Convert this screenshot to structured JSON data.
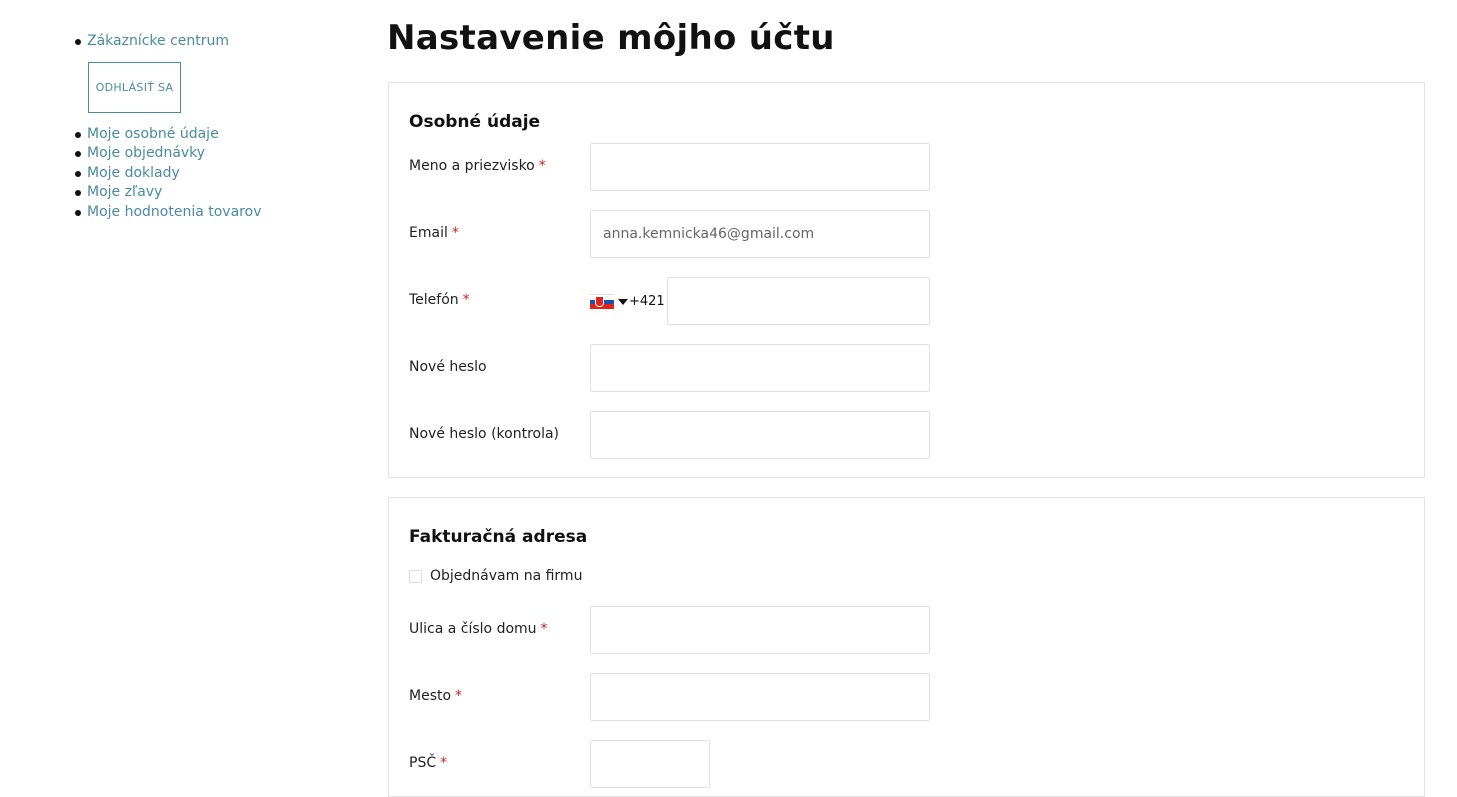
{
  "sidebar": {
    "customer_center": "Zákaznícke centrum",
    "logout_label": "ODHLÁSIŤ SA",
    "items": [
      {
        "label": "Moje osobné údaje"
      },
      {
        "label": "Moje objednávky"
      },
      {
        "label": "Moje doklady"
      },
      {
        "label": "Moje zľavy"
      },
      {
        "label": "Moje hodnotenia tovarov"
      }
    ]
  },
  "page": {
    "title": "Nastavenie môjho účtu"
  },
  "personal": {
    "heading": "Osobné údaje",
    "name": {
      "label": "Meno a priezvisko",
      "required": "*",
      "value": ""
    },
    "email": {
      "label": "Email",
      "required": "*",
      "value": "anna.kemnicka46@gmail.com"
    },
    "phone": {
      "label": "Telefón",
      "required": "*",
      "country": "slovakia-flag-icon",
      "prefix": "+421",
      "value": ""
    },
    "new_password": {
      "label": "Nové heslo",
      "value": ""
    },
    "new_password_check": {
      "label": "Nové heslo (kontrola)",
      "value": ""
    }
  },
  "billing": {
    "heading": "Fakturačná adresa",
    "company_checkbox": {
      "label": "Objednávam na firmu",
      "checked": false
    },
    "street": {
      "label": "Ulica a číslo domu",
      "required": "*",
      "value": ""
    },
    "city": {
      "label": "Mesto",
      "required": "*",
      "value": ""
    },
    "zip": {
      "label": "PSČ",
      "required": "*",
      "value": ""
    }
  },
  "colors": {
    "link": "#4a8aa3",
    "required": "#d0211c",
    "border": "#e4e4e4"
  }
}
